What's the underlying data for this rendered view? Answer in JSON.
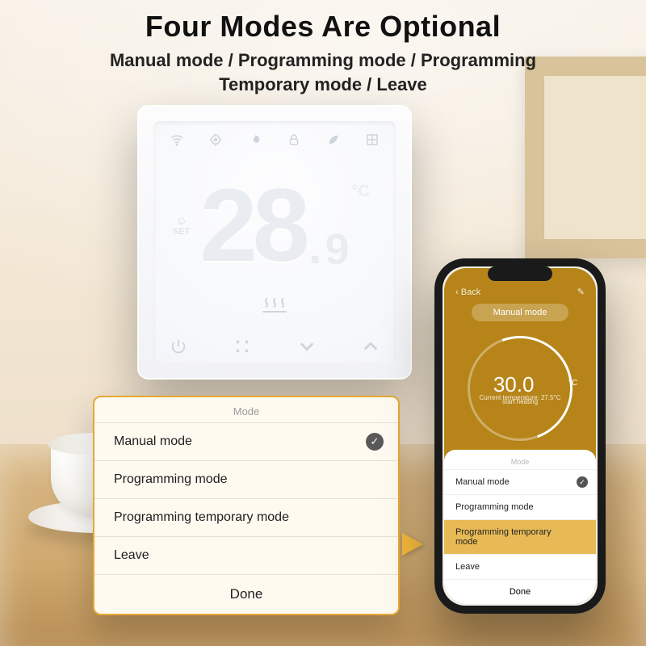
{
  "headline": {
    "title": "Four Modes Are Optional",
    "subtitle_l1": "Manual mode / Programming mode / Programming",
    "subtitle_l2": "Temporary mode / Leave"
  },
  "thermostat": {
    "temp_int": "28",
    "temp_frac": "9",
    "temp_dot": ".",
    "unit": "°C",
    "set_label": "SET",
    "status_icons": [
      "wifi-icon",
      "target-icon",
      "flame-icon",
      "lock-icon",
      "leaf-icon",
      "grid-icon"
    ],
    "bottom_icons": [
      "power-icon",
      "mode-icon",
      "down-icon",
      "up-icon"
    ]
  },
  "mode_popup": {
    "title": "Mode",
    "options": [
      {
        "label": "Manual mode",
        "selected": true
      },
      {
        "label": "Programming mode",
        "selected": false
      },
      {
        "label": "Programming temporary mode",
        "selected": false
      },
      {
        "label": "Leave",
        "selected": false
      }
    ],
    "done": "Done"
  },
  "phone": {
    "back": "Back",
    "pill": "Manual mode",
    "temp": "30.0",
    "unit": "°C",
    "sub1": "Current temperature: 27.5°C",
    "sub2": "start heating",
    "minus": "−",
    "plus": "+",
    "sheet": {
      "title": "Mode",
      "rows": [
        {
          "label": "Manual mode",
          "selected": true,
          "highlight": false
        },
        {
          "label": "Programming mode",
          "selected": false,
          "highlight": false
        },
        {
          "label": "Programming temporary mode",
          "selected": false,
          "highlight": true
        },
        {
          "label": "Leave",
          "selected": false,
          "highlight": false
        }
      ],
      "done": "Done"
    }
  }
}
